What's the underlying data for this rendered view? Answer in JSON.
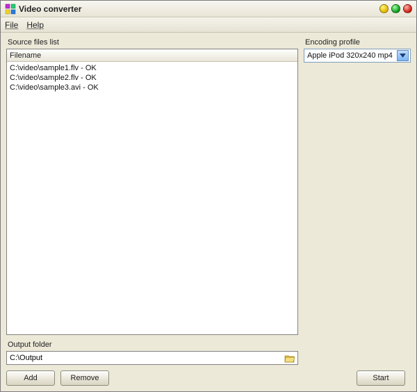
{
  "window": {
    "title": "Video converter"
  },
  "menu": {
    "file": "File",
    "help": "Help"
  },
  "labels": {
    "sourceFiles": "Source files list",
    "filenameHeader": "Filename",
    "encodingProfile": "Encoding profile",
    "outputFolder": "Output folder"
  },
  "files": [
    "C:\\video\\sample1.flv - OK",
    "C:\\video\\sample2.flv - OK",
    "C:\\video\\sample3.avi - OK"
  ],
  "profile": {
    "selected": "Apple iPod 320x240 mp4"
  },
  "output": {
    "path": "C:\\Output"
  },
  "buttons": {
    "add": "Add",
    "remove": "Remove",
    "start": "Start"
  }
}
